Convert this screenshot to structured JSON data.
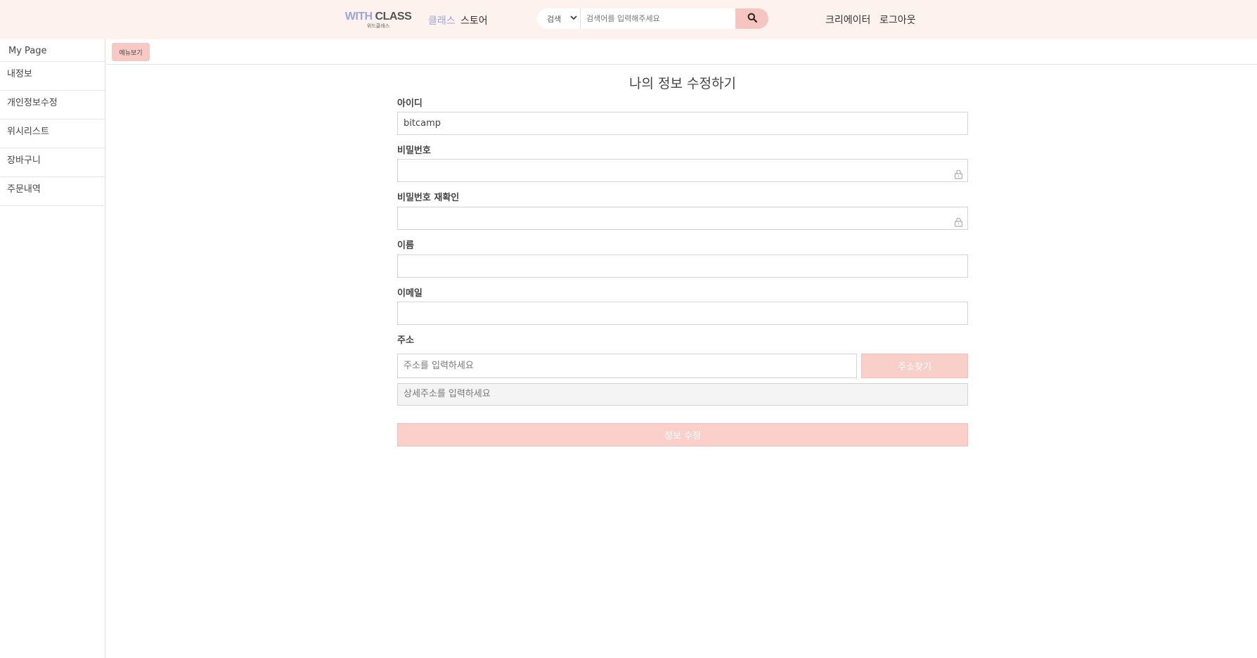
{
  "header": {
    "logo_main_with": "WITH",
    "logo_main_class": "CLASS",
    "logo_sub": "위드클래스",
    "nav_class": "클래스",
    "nav_store": "스토어",
    "search_select": "검색",
    "search_placeholder": "검색어를 입력해주세요",
    "creator": "크리에이터",
    "logout": "로그아웃"
  },
  "sidebar": {
    "title": "My Page",
    "items": [
      "내정보",
      "개인정보수정",
      "위시리스트",
      "장바구니",
      "주문내역"
    ]
  },
  "topbar": {
    "menu_button": "메뉴보기"
  },
  "form": {
    "title": "나의 정보 수정하기",
    "id_label": "아이디",
    "id_value": "bitcamp",
    "password_label": "비밀번호",
    "password_confirm_label": "비밀번호 재확인",
    "name_label": "이름",
    "email_label": "이메일",
    "address_label": "주소",
    "address_placeholder": "주소를 입력하세요",
    "address_button": "주소찾기",
    "address_detail_placeholder": "상세주소를 입력하세요",
    "submit": "정보 수정"
  },
  "colors": {
    "header_bg": "#fdf2ee",
    "accent_pink": "#f8c9c4",
    "logo_blue": "#9aa7d6"
  },
  "icons": {
    "search": "search-icon",
    "lock": "lock-icon",
    "chevron": "chevron-down-icon"
  }
}
